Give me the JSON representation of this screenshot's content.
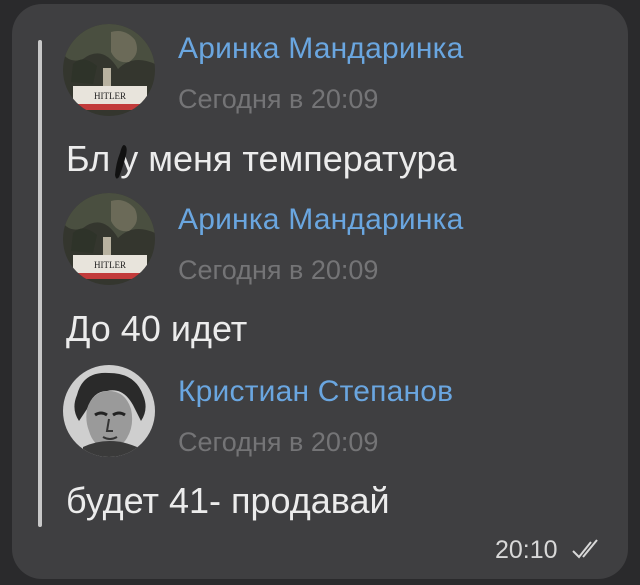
{
  "forwarded": {
    "messages": [
      {
        "author": "Аринка Мандаринка",
        "time": "Сегодня в 20:09",
        "text": "Бл  у меня температура",
        "avatar": "avatar-hitler-sign-icon",
        "avatar_label": "HITLER"
      },
      {
        "author": "Аринка Мандаринка",
        "time": "Сегодня в 20:09",
        "text": "До 40 идет",
        "avatar": "avatar-hitler-sign-icon",
        "avatar_label": "HITLER"
      },
      {
        "author": "Кристиан Степанов",
        "time": "Сегодня в 20:09",
        "text": "будет 41- продавай",
        "avatar": "avatar-statue-icon"
      }
    ]
  },
  "footer": {
    "sent_time": "20:10",
    "status_icon": "double-check-icon"
  },
  "colors": {
    "background": "#2a2a2c",
    "bubble": "#3f3f41",
    "author": "#6aa6e0",
    "timestamp": "#747476",
    "text": "#ececec"
  }
}
